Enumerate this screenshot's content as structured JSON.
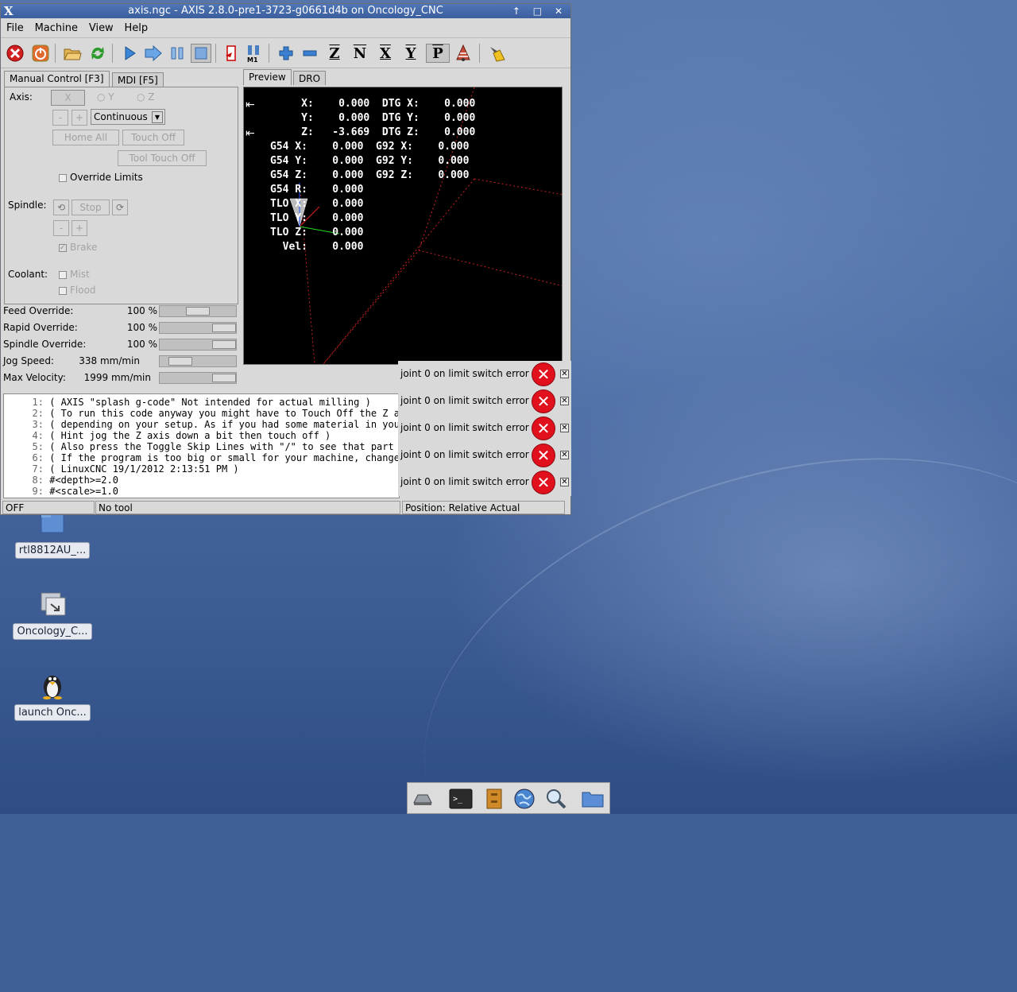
{
  "window": {
    "title": "axis.ngc - AXIS 2.8.0-pre1-3723-g0661d4b on Oncology_CNC",
    "menu_glyph": "X",
    "controls": "↑ □ ✕"
  },
  "menu": [
    "File",
    "Machine",
    "View",
    "Help"
  ],
  "toolbar": {
    "icons": [
      "estop-icon",
      "power-icon",
      "open-icon",
      "reload-icon",
      "run-icon",
      "step-icon",
      "pause-icon",
      "stop-icon",
      "run-from-line-icon",
      "optional-stop-icon",
      "zoom-in-icon",
      "zoom-out-icon",
      "view-z-icon",
      "view-z2-icon",
      "view-x-icon",
      "view-y-icon",
      "view-p-icon",
      "toggle-view-icon",
      "clear-plot-icon"
    ],
    "labels": {
      "z": "Z",
      "z2": "N",
      "x": "X",
      "y": "Y",
      "p": "P",
      "m1": "M1"
    }
  },
  "left_tabs": [
    "Manual Control [F3]",
    "MDI [F5]"
  ],
  "manual": {
    "axis_label": "Axis:",
    "axes": [
      "X",
      "Y",
      "Z"
    ],
    "jog_minus": "-",
    "jog_plus": "+",
    "jog_mode": "Continuous",
    "home_all": "Home All",
    "touch_off": "Touch Off",
    "tool_touch_off": "Tool Touch Off",
    "override_limits": "Override Limits",
    "spindle_label": "Spindle:",
    "spindle_stop": "Stop",
    "brake": "Brake",
    "coolant_label": "Coolant:",
    "mist": "Mist",
    "flood": "Flood"
  },
  "overrides": [
    {
      "label": "Feed Override:",
      "value": "100 %",
      "fraction": 0.5
    },
    {
      "label": "Rapid Override:",
      "value": "100 %",
      "fraction": 1.0
    },
    {
      "label": "Spindle Override:",
      "value": "100 %",
      "fraction": 1.0
    },
    {
      "label": "Jog Speed:",
      "value": "338 mm/min",
      "fraction": 0.17
    },
    {
      "label": "Max Velocity:",
      "value": "1999 mm/min",
      "fraction": 1.0
    }
  ],
  "right_tabs": [
    "Preview",
    "DRO"
  ],
  "dro": [
    "     X:    0.000  DTG X:    0.000",
    "     Y:    0.000  DTG Y:    0.000",
    "     Z:   -3.669  DTG Z:    0.000",
    "G54 X:    0.000  G92 X:    0.000",
    "G54 Y:    0.000  G92 Y:    0.000",
    "G54 Z:    0.000  G92 Z:    0.000",
    "G54 R:    0.000",
    "TLO X:    0.000",
    "TLO Y:    0.000",
    "TLO Z:    0.000",
    "  Vel:    0.000"
  ],
  "code": [
    {
      "n": "1:",
      "t": "( AXIS \"splash g-code\" Not intended for actual milling )"
    },
    {
      "n": "2:",
      "t": "( To run this code anyway you might have to Touch Off the Z axi"
    },
    {
      "n": "3:",
      "t": "( depending on your setup. As if you had some material in your"
    },
    {
      "n": "4:",
      "t": "( Hint jog the Z axis down a bit then touch off )"
    },
    {
      "n": "5:",
      "t": "( Also press the Toggle Skip Lines with \"/\" to see that part )"
    },
    {
      "n": "6:",
      "t": "( If the program is too big or small for your machine, change t"
    },
    {
      "n": "7:",
      "t": "( LinuxCNC 19/1/2012 2:13:51 PM )"
    },
    {
      "n": "8:",
      "t": "#<depth>=2.0"
    },
    {
      "n": "9:",
      "t": "#<scale>=1.0"
    }
  ],
  "status": {
    "state": "OFF",
    "tool": "No tool",
    "position": "Position: Relative Actual"
  },
  "notifications": [
    "joint 0 on limit switch error",
    "joint 0 on limit switch error",
    "joint 0 on limit switch error",
    "joint 0 on limit switch error",
    "joint 0 on limit switch error"
  ],
  "desktop_icons": [
    {
      "label": "rtl8812AU_...",
      "icon": "folder-icon"
    },
    {
      "label": "Oncology_C...",
      "icon": "folder-link-icon"
    },
    {
      "label": "launch Onc...",
      "icon": "penguin-icon"
    }
  ],
  "taskbar": [
    "show-desktop-icon",
    "terminal-icon",
    "file-cabinet-icon",
    "web-browser-icon",
    "search-icon",
    "folder-icon"
  ]
}
